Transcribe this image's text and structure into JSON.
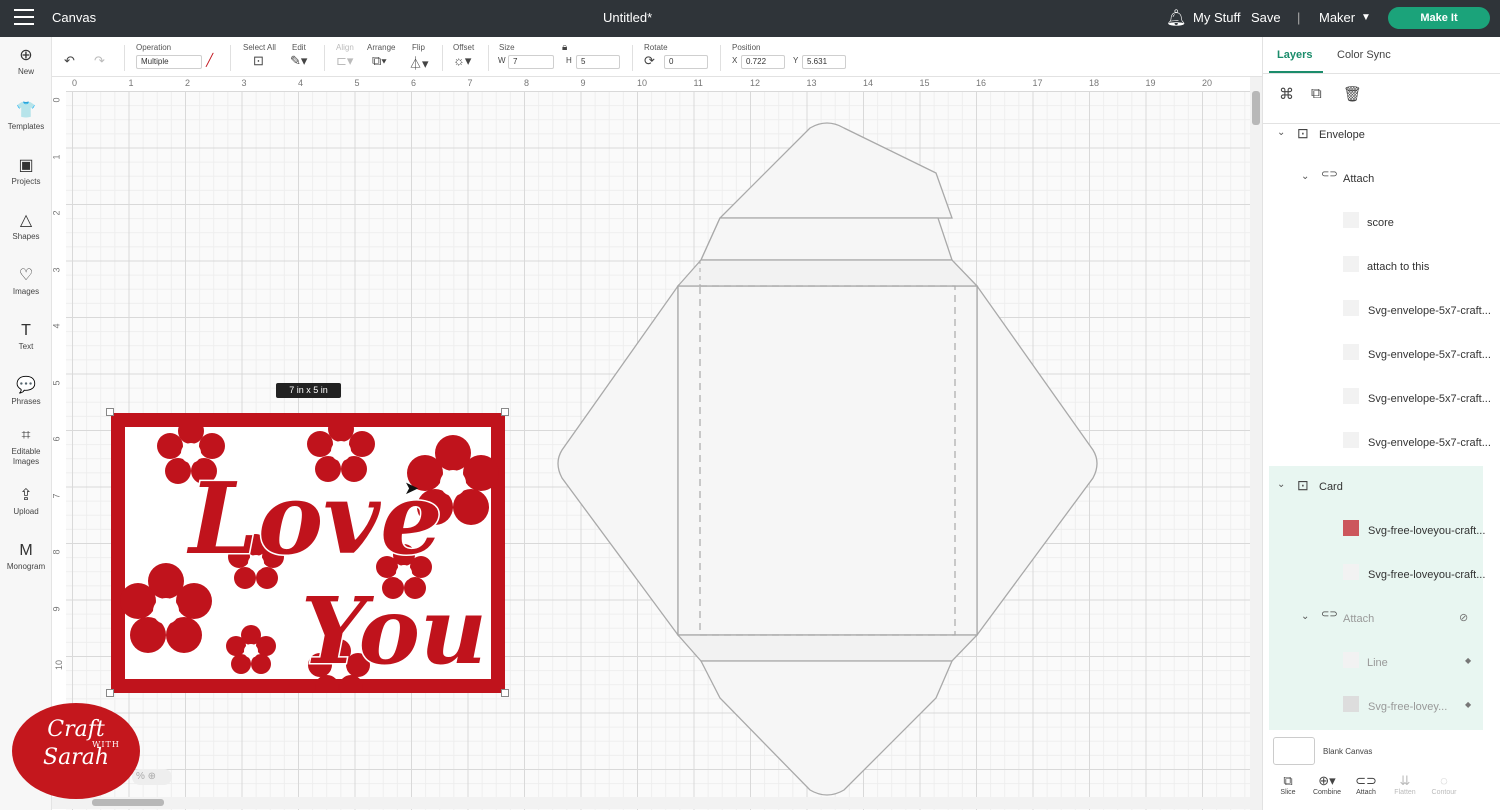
{
  "topbar": {
    "app_title": "Canvas",
    "doc_title": "Untitled*",
    "my_stuff": "My Stuff",
    "save": "Save",
    "divider": "|",
    "machine": "Maker",
    "make_it": "Make It"
  },
  "toolbar": {
    "operation_label": "Operation",
    "operation_value": "Multiple",
    "select_all_label": "Select All",
    "edit_label": "Edit",
    "align_label": "Align",
    "arrange_label": "Arrange",
    "flip_label": "Flip",
    "offset_label": "Offset",
    "size_label": "Size",
    "w_label": "W",
    "w_value": "7",
    "h_label": "H",
    "h_value": "5",
    "rotate_label": "Rotate",
    "rotate_value": "0",
    "position_label": "Position",
    "x_label": "X",
    "x_value": "0.722",
    "y_label": "Y",
    "y_value": "5.631"
  },
  "sidebar": {
    "items": [
      {
        "label": "New",
        "icon": "plus-circle-icon",
        "glyph": "⊕"
      },
      {
        "label": "Templates",
        "icon": "tshirt-icon",
        "glyph": "👕"
      },
      {
        "label": "Projects",
        "icon": "projects-icon",
        "glyph": "▣"
      },
      {
        "label": "Shapes",
        "icon": "shapes-icon",
        "glyph": "△"
      },
      {
        "label": "Images",
        "icon": "balloon-icon",
        "glyph": "♡"
      },
      {
        "label": "Text",
        "icon": "text-icon",
        "glyph": "T"
      },
      {
        "label": "Phrases",
        "icon": "speech-bubble-icon",
        "glyph": "💬"
      },
      {
        "label": "Editable Images",
        "icon": "editable-images-icon",
        "glyph": "⌗"
      },
      {
        "label": "Upload",
        "icon": "upload-icon",
        "glyph": "⇪"
      },
      {
        "label": "Monogram",
        "icon": "monogram-icon",
        "glyph": "M"
      }
    ]
  },
  "rulers": {
    "top": [
      "0",
      "1",
      "2",
      "3",
      "4",
      "5",
      "6",
      "7",
      "8",
      "9",
      "10",
      "11",
      "12",
      "13",
      "14",
      "15",
      "16",
      "17",
      "18",
      "19",
      "20"
    ],
    "left": [
      "0",
      "1",
      "2",
      "3",
      "4",
      "5",
      "6",
      "7",
      "8",
      "9",
      "10"
    ]
  },
  "canvas": {
    "size_tooltip": "7 in x 5 in",
    "card_color": "#c0131c",
    "card_text": "Love You"
  },
  "panel": {
    "tab_layers": "Layers",
    "tab_color_sync": "Color Sync",
    "layers": [
      {
        "name": "Envelope",
        "type": "group"
      },
      {
        "name": "Attach",
        "type": "attach"
      },
      {
        "name": "score",
        "type": "item"
      },
      {
        "name": "attach to this",
        "type": "item"
      },
      {
        "name": "Svg-envelope-5x7-craft...",
        "type": "item"
      },
      {
        "name": "Svg-envelope-5x7-craft...",
        "type": "item"
      },
      {
        "name": "Svg-envelope-5x7-craft...",
        "type": "item"
      },
      {
        "name": "Svg-envelope-5x7-craft...",
        "type": "item"
      },
      {
        "name": "Card",
        "type": "group"
      },
      {
        "name": "Svg-free-loveyou-craft...",
        "type": "item"
      },
      {
        "name": "Svg-free-loveyou-craft...",
        "type": "item"
      },
      {
        "name": "Attach",
        "type": "attach"
      },
      {
        "name": "Line",
        "type": "item"
      },
      {
        "name": "Svg-free-lovey...",
        "type": "item"
      }
    ],
    "blank_canvas": "Blank Canvas",
    "bottom_tools": [
      "Slice",
      "Combine",
      "Attach",
      "Flatten",
      "Contour"
    ]
  },
  "logo": {
    "line1": "Craft",
    "line2": "WITH",
    "line3": "Sarah"
  }
}
